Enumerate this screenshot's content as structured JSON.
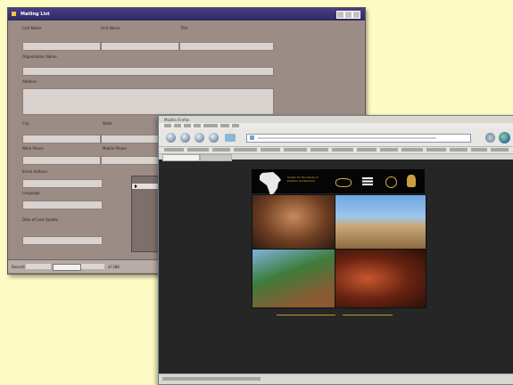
{
  "form_window": {
    "title": "Mailing List",
    "fields": {
      "last_name": "Last Name",
      "first_name": "First Name",
      "title": "Title",
      "organization": "Organization Name",
      "address": "Address",
      "city": "City",
      "state": "State",
      "work_phone": "Work Phone",
      "mobile_phone": "Mobile Phone",
      "email": "Email Address",
      "language": "Language",
      "date_last_updated": "Date of Last Update"
    },
    "status": {
      "record_label": "Record:",
      "of_label": "of 388"
    }
  },
  "browser": {
    "title": "Mozilla Firefox",
    "url": "",
    "site": {
      "heading": "Center for the Study of Earthen Architecture"
    }
  },
  "colors": {
    "background": "#fdfbc4",
    "form_title": "#3a3176",
    "page_bg": "#262626"
  }
}
